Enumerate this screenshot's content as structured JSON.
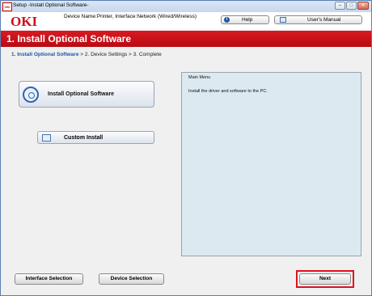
{
  "window": {
    "title": "Setup -Install Optional Software-",
    "icon_text": "OKI",
    "controls": [
      "minimize-icon",
      "maximize-icon",
      "close-icon"
    ]
  },
  "header": {
    "logo": "OKI",
    "device_info": "Device Name:Printer, Interface:Network (Wired/Wireless)",
    "help_label": "Help",
    "help_icon_text": "i",
    "manual_label": "User's Manual"
  },
  "banner": {
    "title": "1. Install Optional Software"
  },
  "steps": {
    "current": "1. Install Optional Software",
    "rest": " > 2. Device Settings > 3. Complete"
  },
  "main": {
    "install_button": "Install Optional Software",
    "custom_button": "Custom Install"
  },
  "menu_panel": {
    "title": "Main Menu",
    "description": "Install the driver and software to the PC."
  },
  "footer": {
    "interface_selection": "Interface Selection",
    "device_selection": "Device Selection",
    "next": "Next"
  },
  "colors": {
    "brand_red": "#d0101c",
    "accent_blue": "#1f56a8",
    "panel_bg": "#dde9f1"
  }
}
